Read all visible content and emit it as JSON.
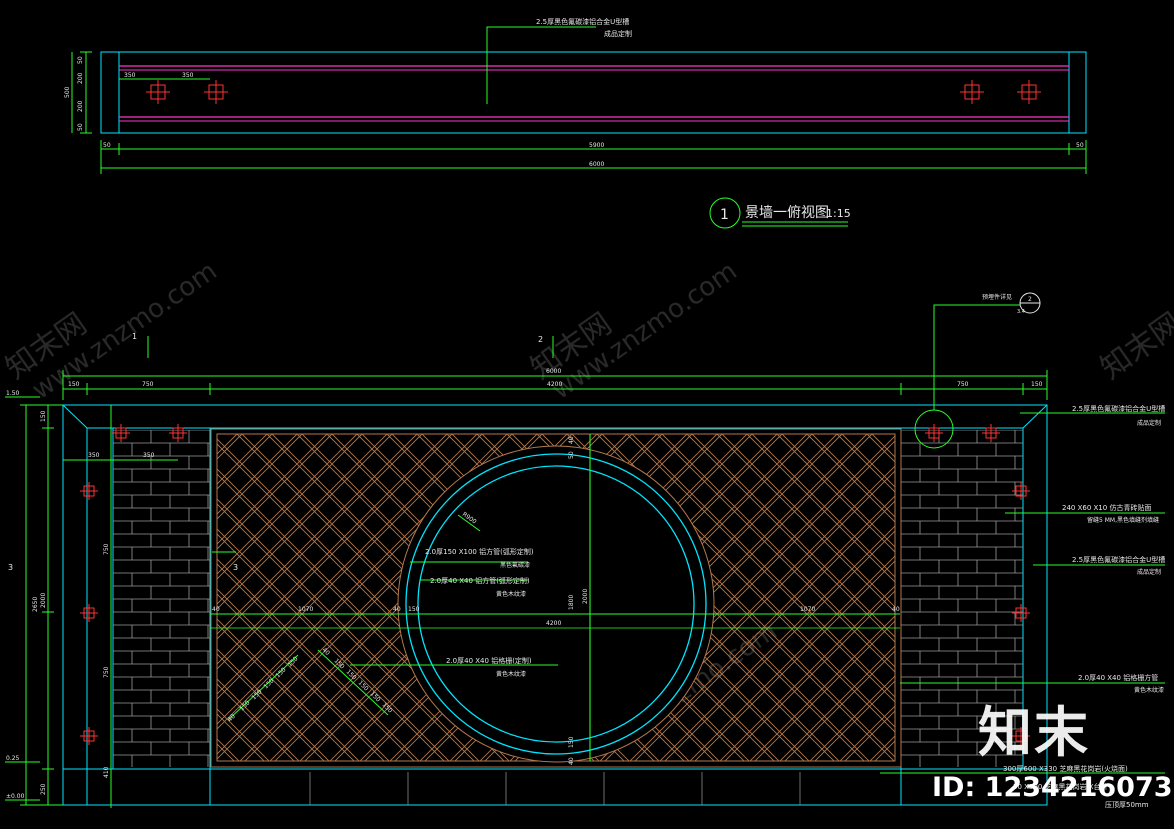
{
  "top_view": {
    "callout": "2.5厚黑色氟碳漆铝合金U型槽",
    "callout_sub": "成品定制",
    "dims_top": [
      "350",
      "350"
    ],
    "dims_side": [
      "50",
      "200",
      "200",
      "50"
    ],
    "dim_side_total": "500",
    "dims_bottom": [
      "50",
      "5900",
      "50"
    ],
    "dim_total": "6000"
  },
  "title": {
    "number": "1",
    "text": "景墙一俯视图",
    "scale": "1:15"
  },
  "elevation": {
    "section_marks": [
      "1",
      "2",
      "3",
      "3"
    ],
    "detail_callout": "预埋件详见",
    "detail_callout_sub": "3.4",
    "detail_bubble": "2",
    "dims_top_total": "6000",
    "dims_top": [
      "150",
      "750",
      "4200",
      "750",
      "150"
    ],
    "dims_left": [
      "150",
      "2650",
      "2000",
      "750",
      "750",
      "410",
      "250"
    ],
    "levels": [
      "1.50",
      "0.25",
      "±0.00"
    ],
    "inner_dims_top": [
      "350",
      "350"
    ],
    "center_dims": [
      "40",
      "1070",
      "40",
      "150",
      "1070",
      "40"
    ],
    "center_total": "4200",
    "vertical_dims": [
      "40",
      "50",
      "450",
      "1800",
      "2000",
      "150",
      "40"
    ],
    "radius": "R900",
    "diag_dims_a": [
      "40",
      "150",
      "150",
      "150",
      "150",
      "150"
    ],
    "diag_dims_b": [
      "40",
      "150",
      "150",
      "150",
      "150",
      "150"
    ],
    "labels_center": [
      {
        "line1": "2.0厚150 X100 铝方管(弧形定制)",
        "line2": "黑色氟碳漆"
      },
      {
        "line1": "2.0厚40 X40 铝方管(弧形定制)",
        "line2": "黄色木纹漆"
      },
      {
        "line1": "2.0厚40 X40 铝格栅(定制)",
        "line2": "黄色木纹漆"
      }
    ],
    "labels_right": [
      {
        "line1": "2.5厚黑色氟碳漆铝合金U型槽",
        "line2": "成品定制"
      },
      {
        "line1": "240 X60 X10 仿古青砖贴面",
        "line2": "留缝5 MM,黑色填缝剂填缝"
      },
      {
        "line1": "2.5厚黑色氟碳漆铝合金U型槽",
        "line2": "成品定制"
      },
      {
        "line1": "2.0厚40 X40 铝格栅方管",
        "line2": "黄色木纹漆"
      }
    ],
    "labels_bottom": [
      "300厚600 X330 芝麻黑花岗岩(火烧面)",
      "50 X300 芝麻黑花岗岩 X台阶",
      "压顶厚50mm"
    ]
  },
  "watermark": {
    "brand": "知末",
    "id_text": "ID: 1234216073",
    "cn_site": "知末网",
    "url": "www.znzmo.com"
  },
  "colors": {
    "background": "#000000",
    "line_cyan": "#00e5ff",
    "line_green": "#29ff29",
    "line_magenta": "#ff33cc",
    "line_red": "#ff3333",
    "line_brown": "#b3784d",
    "text": "#e8e8e8"
  }
}
